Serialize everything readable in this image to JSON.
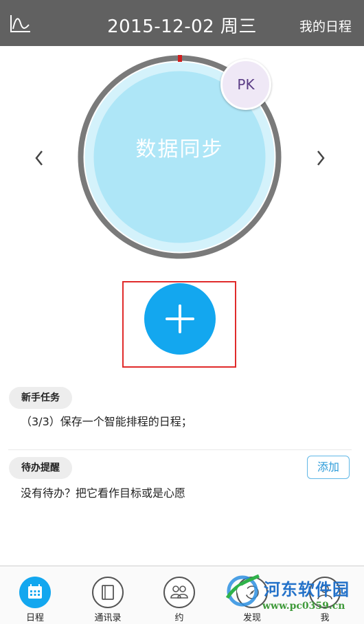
{
  "header": {
    "date_title": "2015-12-02 周三",
    "my_schedule": "我的日程",
    "chart_icon": "line-chart-icon"
  },
  "sync": {
    "label": "数据同步",
    "pk_label": "PK"
  },
  "tasks": {
    "newbie_tag": "新手任务",
    "newbie_text": "（3/3）保存一个智能排程的日程；",
    "todo_tag": "待办提醒",
    "todo_add": "添加",
    "todo_text": "没有待办？把它看作目标或是心愿"
  },
  "nav": [
    {
      "label": "日程",
      "icon": "calendar-icon",
      "active": true
    },
    {
      "label": "通讯录",
      "icon": "contacts-book-icon",
      "active": false
    },
    {
      "label": "约",
      "icon": "people-icon",
      "active": false
    },
    {
      "label": "发现",
      "icon": "compass-icon",
      "active": false
    },
    {
      "label": "我",
      "icon": "person-icon",
      "active": false
    }
  ],
  "watermark": {
    "name": "河东软件园",
    "url": "www.pc0359.cn"
  },
  "colors": {
    "topbar": "#616161",
    "accent": "#13a7ef",
    "ring": "#7a7a7a",
    "circle": "#aee6f7",
    "highlight_box": "#e02a2a"
  }
}
